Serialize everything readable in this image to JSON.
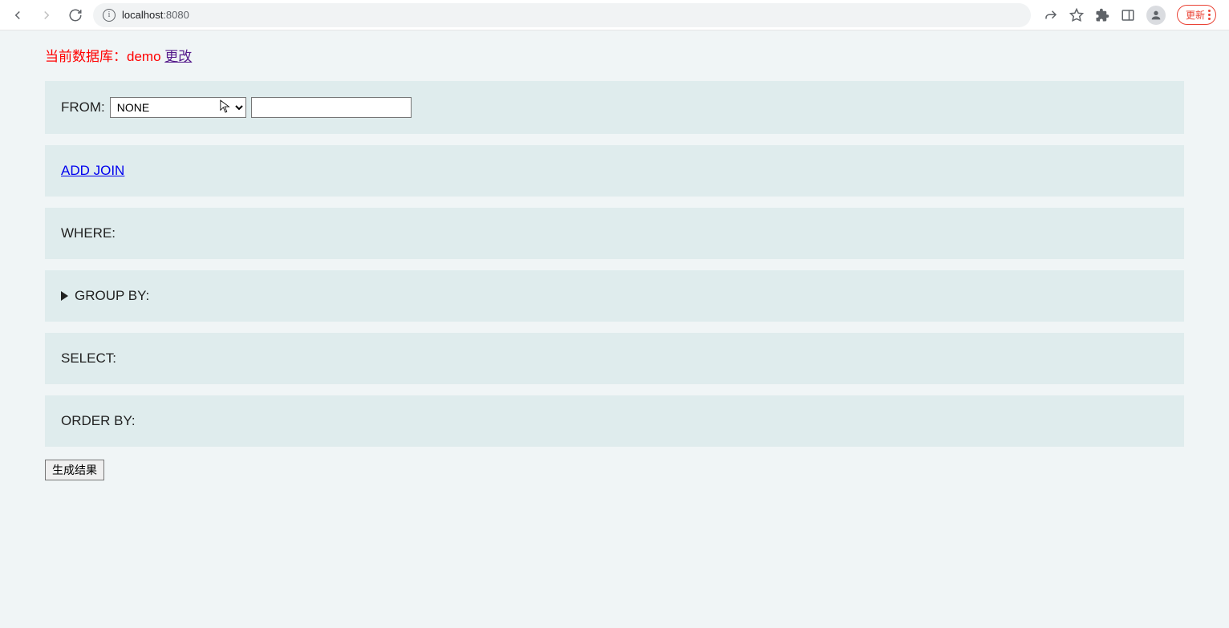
{
  "browser": {
    "url_host": "localhost",
    "url_port": ":8080",
    "update_label": "更新"
  },
  "db_header": {
    "prefix": "当前数据库：",
    "name": "demo",
    "change_link": "更改"
  },
  "panels": {
    "from_label": "FROM:",
    "from_select_value": "NONE",
    "from_input_value": "",
    "add_join": "ADD JOIN",
    "where": "WHERE:",
    "group_by": "GROUP BY:",
    "select": "SELECT:",
    "order_by": "ORDER BY:"
  },
  "generate_button": "生成结果"
}
